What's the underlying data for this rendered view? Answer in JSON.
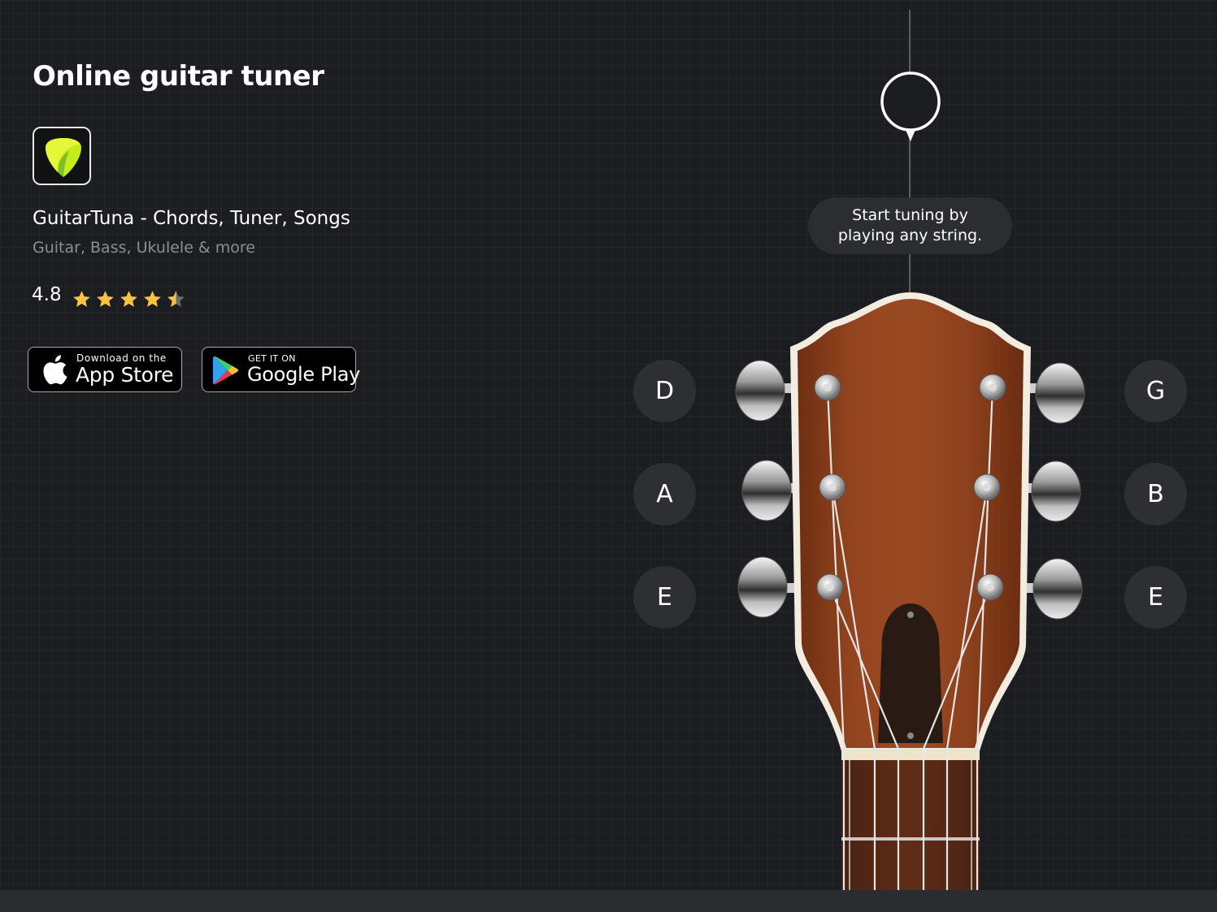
{
  "page": {
    "title": "Online guitar tuner"
  },
  "app": {
    "name": "GuitarTuna - Chords, Tuner, Songs",
    "subtitle": "Guitar, Bass, Ukulele & more",
    "rating": "4.8",
    "stars": 4.5,
    "icon": "guitar-pick-icon"
  },
  "stores": {
    "appstore": {
      "small": "Download on the",
      "big": "App Store",
      "icon": "apple-icon"
    },
    "googleplay": {
      "small": "GET IT ON",
      "big": "Google Play",
      "icon": "google-play-icon"
    }
  },
  "tuner": {
    "hint_line1": "Start tuning by",
    "hint_line2": "playing any string.",
    "strings_left": [
      "D",
      "A",
      "E"
    ],
    "strings_right": [
      "G",
      "B",
      "E"
    ]
  },
  "colors": {
    "background": "#1c1d20",
    "button": "#2e2f33",
    "star": "#f7c343",
    "icon_green": "#c6ec1a",
    "wood": "#8b3f1c"
  }
}
